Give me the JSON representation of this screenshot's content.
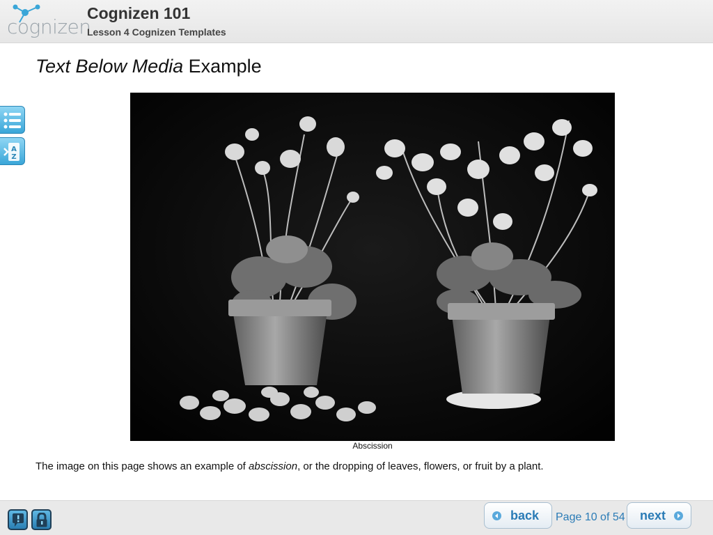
{
  "header": {
    "logo_text": "cognizen",
    "course_title": "Cognizen 101",
    "lesson_title": "Lesson 4 Cognizen Templates"
  },
  "page": {
    "title_italic": "Text Below Media",
    "title_rest": " Example"
  },
  "media": {
    "caption": "Abscission"
  },
  "body": {
    "text_before": "The image on this page shows an example of ",
    "text_emphasis": "abscission",
    "text_after": ", or the dropping of leaves, flowers, or fruit by a plant."
  },
  "side_tools": [
    {
      "icon": "list-icon"
    },
    {
      "icon": "az-glossary-icon"
    }
  ],
  "footer": {
    "help_icon": "help-icon",
    "lock_icon": "lock-icon",
    "back_label": "back",
    "next_label": "next",
    "page_indicator": "Page 10 of 54"
  },
  "colors": {
    "accent": "#2a7bb6",
    "header_bg": "#ececec",
    "footer_bg": "#e9e9e9"
  }
}
